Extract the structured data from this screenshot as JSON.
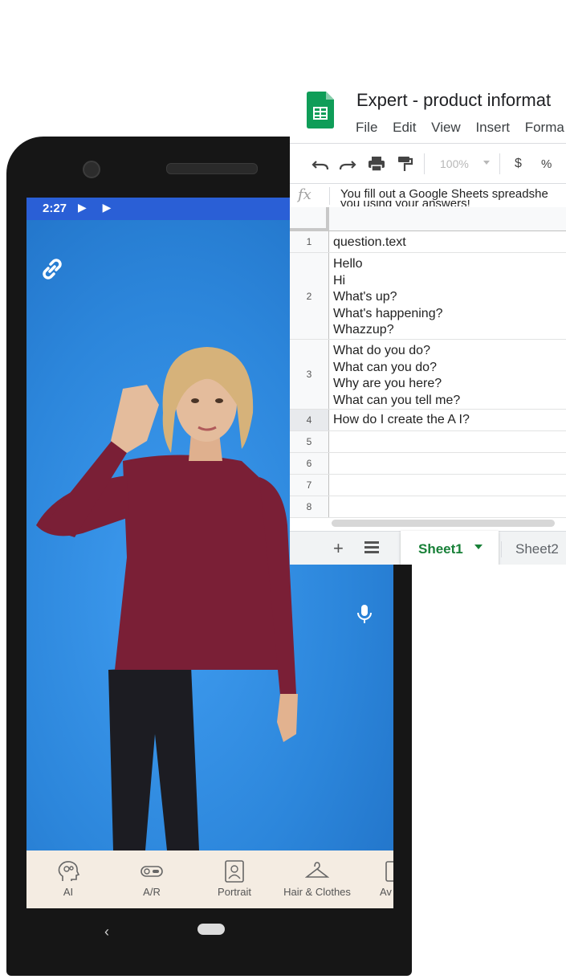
{
  "phone": {
    "status_time": "2:27",
    "status_icons": "▶ ▶",
    "link_icon": "link-icon",
    "mic_icon": "mic-icon",
    "nav": [
      {
        "label": "AI",
        "icon": "ai-head-icon"
      },
      {
        "label": "A/R",
        "icon": "toggle-icon"
      },
      {
        "label": "Portrait",
        "icon": "portrait-icon"
      },
      {
        "label": "Hair & Clothes",
        "icon": "hanger-icon"
      },
      {
        "label": "Av",
        "icon": "avatar-icon"
      }
    ],
    "back_glyph": "‹",
    "colors": {
      "status_bar": "#2a5fd6",
      "scene": "#2c86db",
      "nav_bg": "#f4ece2"
    }
  },
  "sheets": {
    "title": "Expert - product informat",
    "menu": [
      "File",
      "Edit",
      "View",
      "Insert",
      "Forma"
    ],
    "toolbar": {
      "zoom": "100%",
      "currency": "$",
      "percent": "%"
    },
    "formula": {
      "fx": "fx",
      "line1": "You fill out a Google Sheets spreadshe",
      "line2": "you using your answers!"
    },
    "rows": [
      {
        "num": "1",
        "text": "question.text"
      },
      {
        "num": "2",
        "text": "Hello\nHi\nWhat's up?\nWhat's happening?\nWhazzup?"
      },
      {
        "num": "3",
        "text": "What do you do?\nWhat can you do?\nWhy are you here?\nWhat can you tell me?"
      },
      {
        "num": "4",
        "text": "How do I create the A I?"
      },
      {
        "num": "5",
        "text": ""
      },
      {
        "num": "6",
        "text": ""
      },
      {
        "num": "7",
        "text": ""
      },
      {
        "num": "8",
        "text": ""
      }
    ],
    "tabs": {
      "add": "+",
      "active": "Sheet1",
      "inactive": "Sheet2"
    },
    "colors": {
      "logo": "#0f9d58",
      "active_tab": "#188038"
    }
  }
}
